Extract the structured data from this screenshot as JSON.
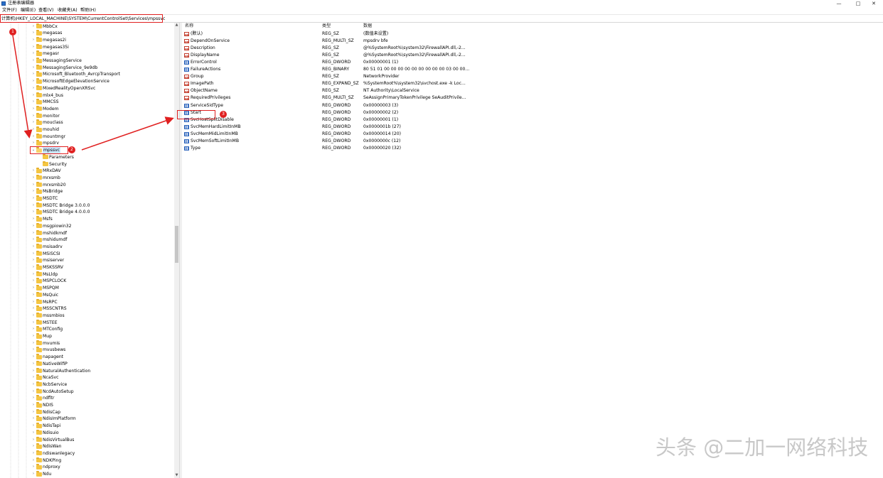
{
  "window": {
    "title": "注册表编辑器",
    "controls": {
      "minimize": "—",
      "maximize": "□",
      "close": "✕"
    }
  },
  "menu": {
    "file": "文件(F)",
    "edit": "编辑(E)",
    "view": "查看(V)",
    "favorites": "收藏夹(A)",
    "help": "帮助(H)"
  },
  "address": {
    "path": "计算机\\HKEY_LOCAL_MACHINE\\SYSTEM\\CurrentControlSet\\Services\\mpssvc"
  },
  "tree": {
    "items_before": [
      "MbbCx",
      "megasas",
      "megasas2i",
      "megasas35i",
      "megasr",
      "MessagingService",
      "MessagingService_9e9db",
      "Microsoft_Bluetooth_AvrcpTransport",
      "MicrosoftEdgeElevationService",
      "MixedRealityOpenXRSvc",
      "mlx4_bus",
      "MMCSS",
      "Modem",
      "monitor",
      "mouclass",
      "mouhid",
      "mountmgr",
      "mpsdrv"
    ],
    "selected": "mpssvc",
    "children": [
      "Parameters",
      "Security"
    ],
    "items_after": [
      "MRxDAV",
      "mrxsmb",
      "mrxsmb20",
      "MsBridge",
      "MSDTC",
      "MSDTC Bridge 3.0.0.0",
      "MSDTC Bridge 4.0.0.0",
      "Msfs",
      "msgpiowin32",
      "mshidkmdf",
      "mshidumdf",
      "msisadrv",
      "MSiSCSI",
      "msiserver",
      "MSKSSRV",
      "MsLldp",
      "MSPCLOCK",
      "MSPQM",
      "MsQuic",
      "MsRPC",
      "MSSCNTRS",
      "mssmbios",
      "MSTEE",
      "MTConfig",
      "Mup",
      "mvumis",
      "mvusbews",
      "napagent",
      "NativeWifiP",
      "NaturalAuthentication",
      "NcaSvc",
      "NcbService",
      "NcdAutoSetup",
      "ndfltr",
      "NDIS",
      "NdisCap",
      "NdisImPlatform",
      "NdisTapi",
      "Ndisuio",
      "NdisVirtualBus",
      "NdisWan",
      "ndiswanlegacy",
      "NDKPing",
      "ndproxy",
      "Ndu"
    ]
  },
  "values": {
    "headers": {
      "name": "名称",
      "type": "类型",
      "data": "数据"
    },
    "rows": [
      {
        "icon": "string-value-icon",
        "name": "(默认)",
        "type": "REG_SZ",
        "data": "(数值未设置)"
      },
      {
        "icon": "string-value-icon",
        "name": "DependOnService",
        "type": "REG_MULTI_SZ",
        "data": "mpsdrv bfe"
      },
      {
        "icon": "string-value-icon",
        "name": "Description",
        "type": "REG_SZ",
        "data": "@%SystemRoot%\\system32\\FirewallAPI.dll,-2..."
      },
      {
        "icon": "string-value-icon",
        "name": "DisplayName",
        "type": "REG_SZ",
        "data": "@%SystemRoot%\\system32\\FirewallAPI.dll,-2..."
      },
      {
        "icon": "binary-value-icon",
        "name": "ErrorControl",
        "type": "REG_DWORD",
        "data": "0x00000001 (1)"
      },
      {
        "icon": "binary-value-icon",
        "name": "FailureActions",
        "type": "REG_BINARY",
        "data": "80 51 01 00 00 00 00 00 00 00 00 00 03 00 00..."
      },
      {
        "icon": "string-value-icon",
        "name": "Group",
        "type": "REG_SZ",
        "data": "NetworkProvider"
      },
      {
        "icon": "string-value-icon",
        "name": "ImagePath",
        "type": "REG_EXPAND_SZ",
        "data": "%SystemRoot%\\system32\\svchost.exe -k Loc..."
      },
      {
        "icon": "string-value-icon",
        "name": "ObjectName",
        "type": "REG_SZ",
        "data": "NT Authority\\LocalService"
      },
      {
        "icon": "string-value-icon",
        "name": "RequiredPrivileges",
        "type": "REG_MULTI_SZ",
        "data": "SeAssignPrimaryTokenPrivilege SeAuditPrivile..."
      },
      {
        "icon": "binary-value-icon",
        "name": "ServiceSidType",
        "type": "REG_DWORD",
        "data": "0x00000003 (3)"
      },
      {
        "icon": "binary-value-icon",
        "name": "Start",
        "type": "REG_DWORD",
        "data": "0x00000002 (2)"
      },
      {
        "icon": "binary-value-icon",
        "name": "SvcHostSplitDisable",
        "type": "REG_DWORD",
        "data": "0x00000001 (1)"
      },
      {
        "icon": "binary-value-icon",
        "name": "SvcMemHardLimitInMB",
        "type": "REG_DWORD",
        "data": "0x0000001b (27)"
      },
      {
        "icon": "binary-value-icon",
        "name": "SvcMemMidLimitInMB",
        "type": "REG_DWORD",
        "data": "0x00000014 (20)"
      },
      {
        "icon": "binary-value-icon",
        "name": "SvcMemSoftLimitInMB",
        "type": "REG_DWORD",
        "data": "0x0000000c (12)"
      },
      {
        "icon": "binary-value-icon",
        "name": "Type",
        "type": "REG_DWORD",
        "data": "0x00000020 (32)"
      }
    ]
  },
  "annotations": {
    "badge1": "1",
    "badge2": "2",
    "badge3": "3",
    "color": "#e02020"
  },
  "watermark": "头条 @二加一网络科技"
}
